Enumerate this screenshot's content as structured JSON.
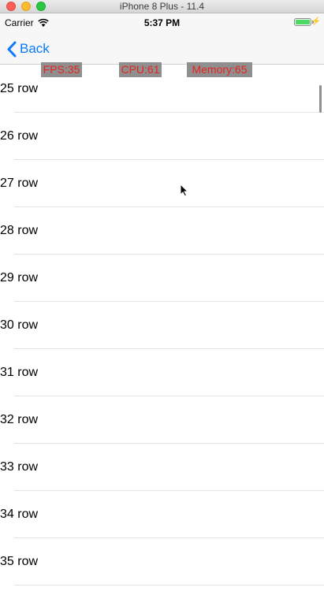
{
  "window": {
    "title": "iPhone 8 Plus - 11.4"
  },
  "status_bar": {
    "carrier": "Carrier",
    "time": "5:37 PM",
    "battery_level": 1.0
  },
  "nav": {
    "back_label": "Back"
  },
  "monitor": {
    "fps": "FPS:35",
    "cpu": "CPU:61",
    "memory": "Memory:65"
  },
  "rows": [
    "25 row",
    "26 row",
    "27 row",
    "28 row",
    "29 row",
    "30 row",
    "31 row",
    "32 row",
    "33 row",
    "34 row",
    "35 row"
  ],
  "colors": {
    "accent": "#0a7aff",
    "monitor_text": "#e8231f",
    "monitor_bg": "#8f8f8f"
  }
}
